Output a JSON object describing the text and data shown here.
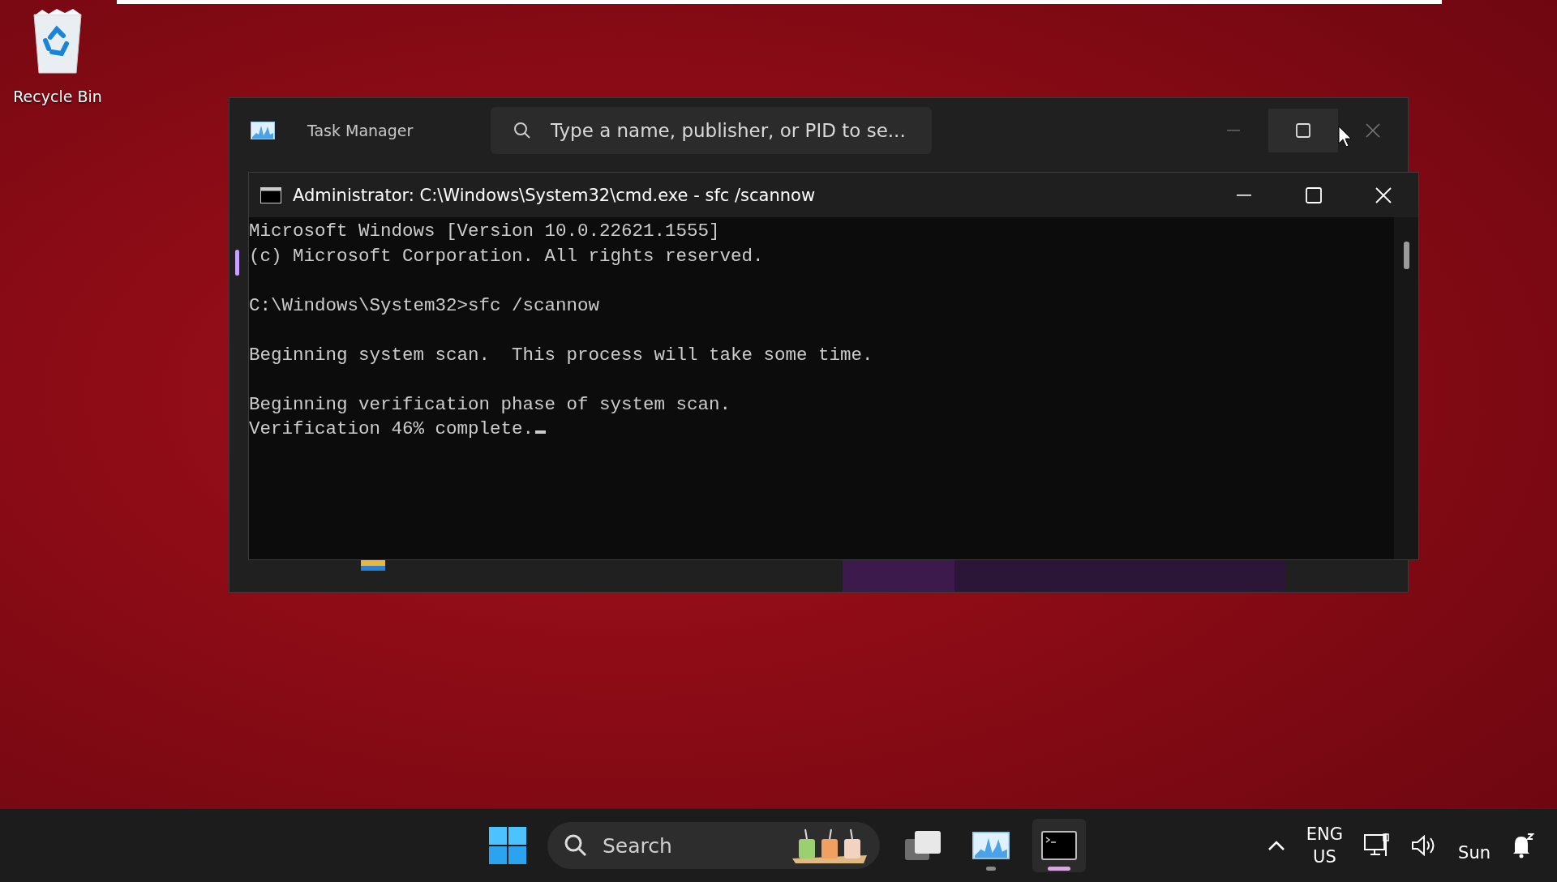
{
  "desktop": {
    "icons": [
      {
        "label": "Recycle Bin"
      }
    ]
  },
  "task_manager": {
    "title": "Task Manager",
    "search": {
      "placeholder": "Type a name, publisher, or PID to se..."
    }
  },
  "console": {
    "title": "Administrator: C:\\Windows\\System32\\cmd.exe - sfc  /scannow",
    "blocks": [
      [
        "Microsoft Windows [Version 10.0.22621.1555]",
        "(c) Microsoft Corporation. All rights reserved."
      ],
      [
        "C:\\Windows\\System32>sfc /scannow"
      ],
      [
        "Beginning system scan.  This process will take some time."
      ],
      [
        "Beginning verification phase of system scan.",
        "Verification 46% complete."
      ]
    ]
  },
  "taskbar": {
    "search": {
      "placeholder": "Search"
    },
    "apps": [
      {
        "kind": "task-view",
        "running": false,
        "selected": false
      },
      {
        "kind": "task-manager",
        "running": true,
        "selected": false
      },
      {
        "kind": "terminal",
        "running": true,
        "selected": true
      }
    ],
    "language": [
      "ENG",
      "US"
    ],
    "day": "Sun"
  }
}
